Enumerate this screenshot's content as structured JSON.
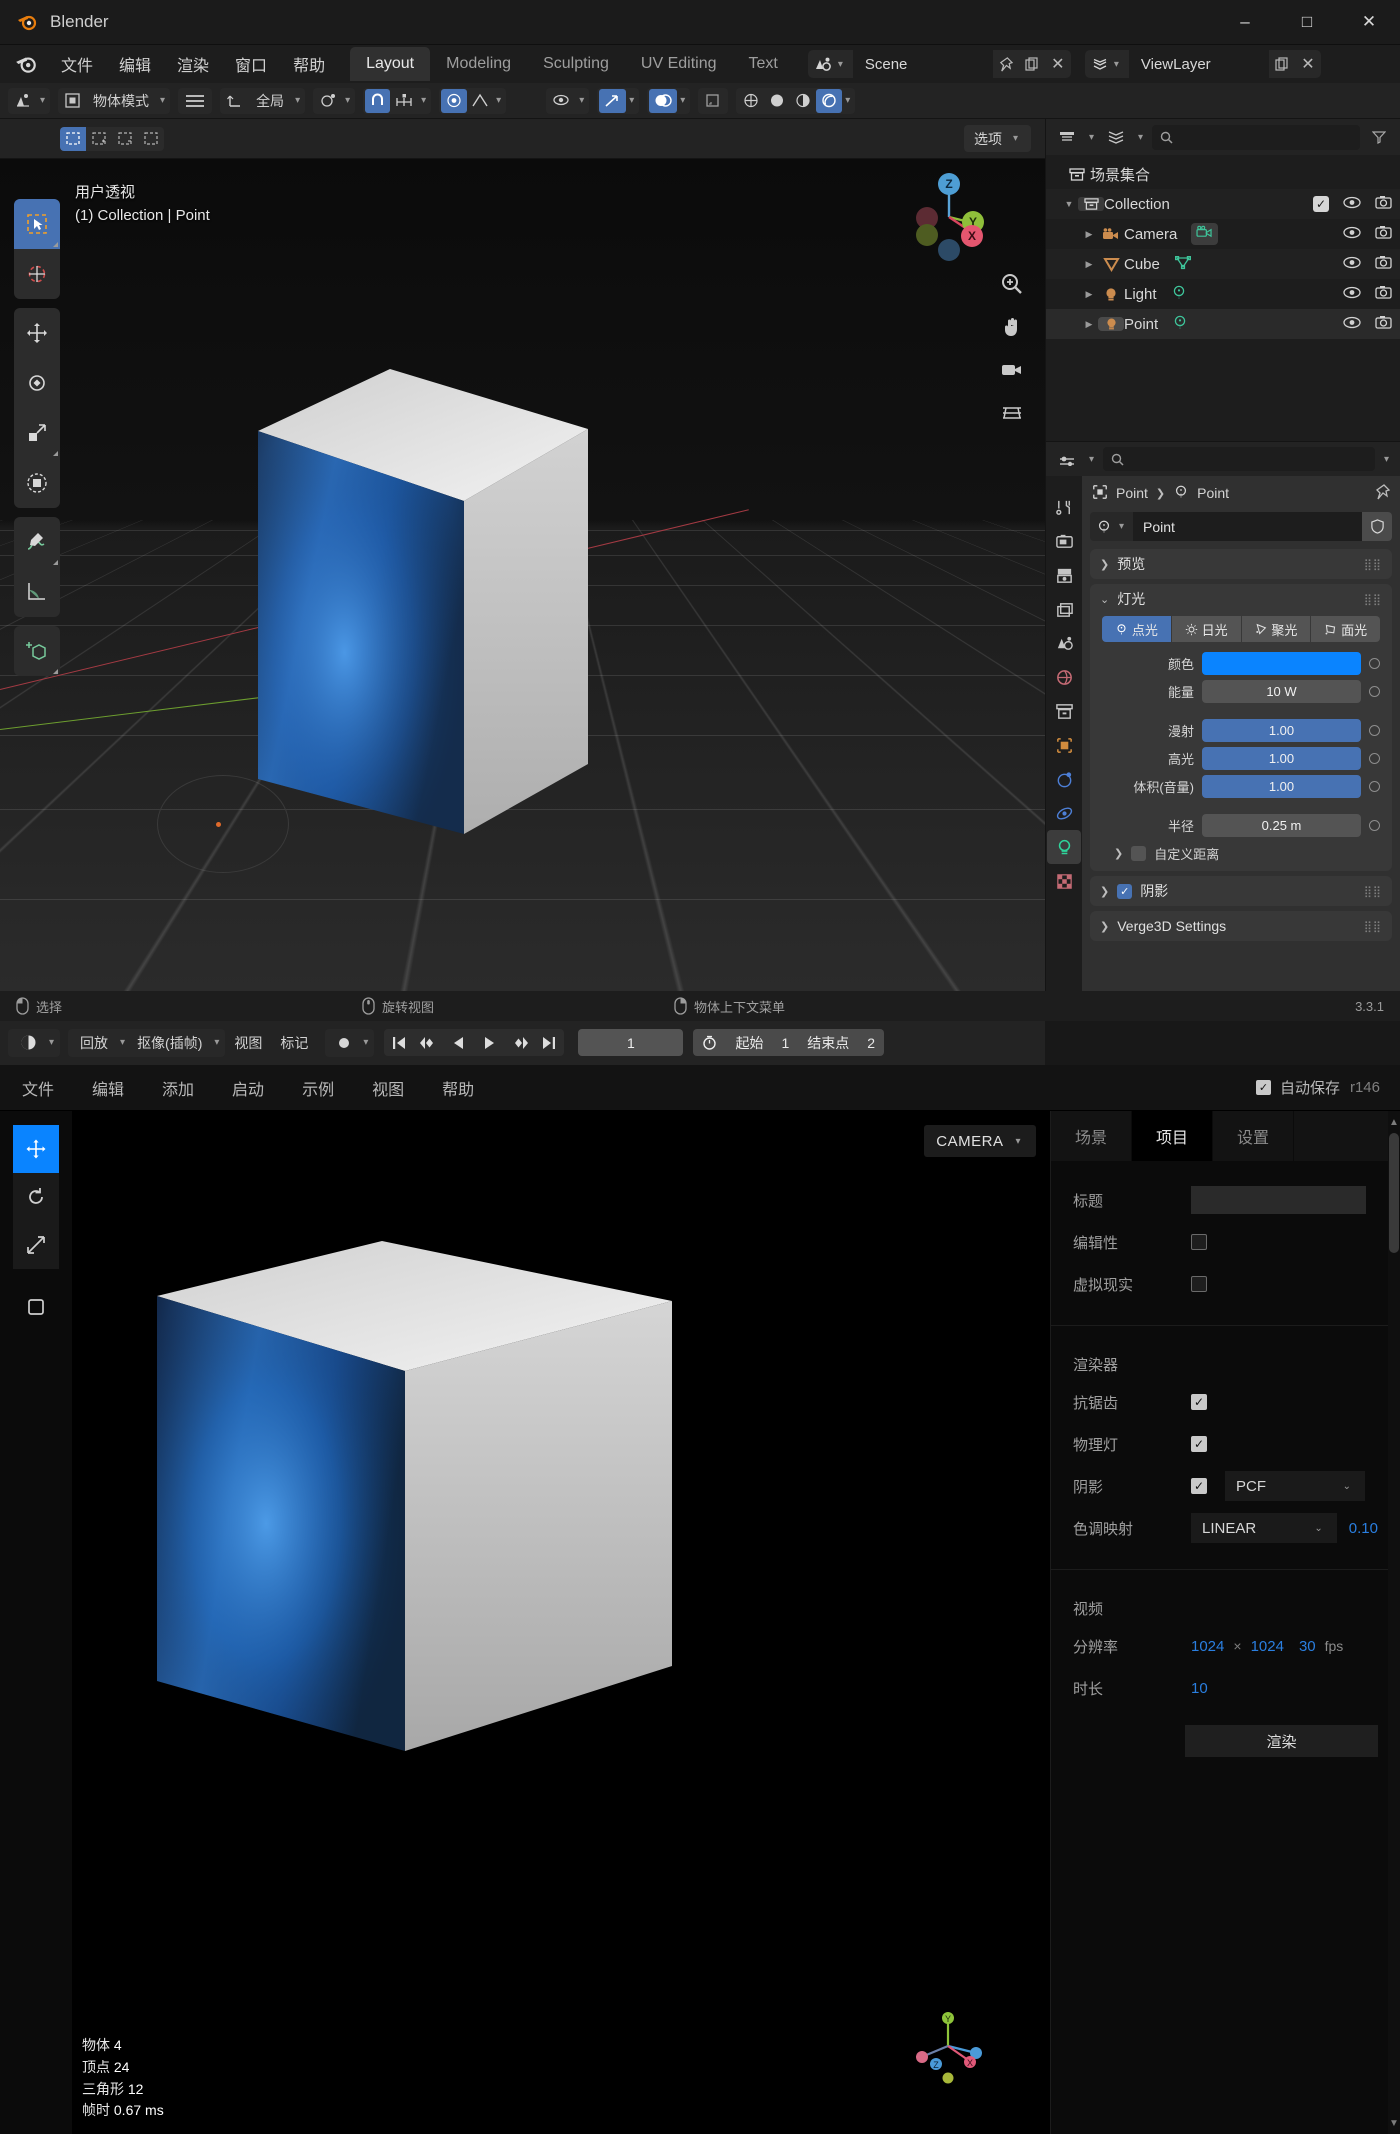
{
  "window": {
    "title": "Blender",
    "minimize": "–",
    "maximize": "□",
    "close": "✕"
  },
  "blender": {
    "menus": [
      "文件",
      "编辑",
      "渲染",
      "窗口",
      "帮助"
    ],
    "workspace_tabs": [
      {
        "label": "Layout",
        "active": true
      },
      {
        "label": "Modeling",
        "active": false
      },
      {
        "label": "Sculpting",
        "active": false
      },
      {
        "label": "UV Editing",
        "active": false
      },
      {
        "label": "Text",
        "active": false
      }
    ],
    "scene_name": "Scene",
    "view_layer_name": "ViewLayer",
    "header": {
      "mode": "物体模式",
      "transform_orientation": "全局"
    },
    "viewport": {
      "options_label": "选项",
      "overlay_line1": "用户透视",
      "overlay_line2": "(1) Collection | Point",
      "gizmo_axes": [
        "X",
        "Y",
        "Z"
      ]
    },
    "timeline": {
      "playback": "回放",
      "keying": "抠像(插帧)",
      "view": "视图",
      "marker": "标记",
      "current_frame": "1",
      "start_label": "起始",
      "start_value": "1",
      "end_label": "结束点",
      "end_value": "2"
    },
    "statusbar": {
      "select": "选择",
      "rotate_view": "旋转视图",
      "object_context_menu": "物体上下文菜单",
      "version": "3.3.1"
    },
    "outliner": {
      "scene_collection": "场景集合",
      "rows": [
        {
          "label": "Collection",
          "indent": 1,
          "icon": "collection-icon",
          "has_checkbox": true,
          "selected": false
        },
        {
          "label": "Camera",
          "indent": 2,
          "icon": "camera-icon",
          "has_checkbox": false,
          "selected": false
        },
        {
          "label": "Cube",
          "indent": 2,
          "icon": "mesh-icon",
          "has_checkbox": false,
          "selected": false
        },
        {
          "label": "Light",
          "indent": 2,
          "icon": "light-icon",
          "has_checkbox": false,
          "selected": false
        },
        {
          "label": "Point",
          "indent": 2,
          "icon": "light-icon",
          "has_checkbox": false,
          "selected": true
        }
      ]
    },
    "properties": {
      "breadcrumb_object": "Point",
      "breadcrumb_data": "Point",
      "id_name": "Point",
      "panel_preview": "预览",
      "panel_light": "灯光",
      "light_types": [
        {
          "label": "点光",
          "active": true
        },
        {
          "label": "日光",
          "active": false
        },
        {
          "label": "聚光",
          "active": false
        },
        {
          "label": "面光",
          "active": false
        }
      ],
      "fields": [
        {
          "label": "颜色",
          "value": "",
          "style": "color",
          "color": "#0a84ff"
        },
        {
          "label": "能量",
          "value": "10 W",
          "style": "grey"
        },
        {
          "label": "漫射",
          "value": "1.00",
          "style": "blue"
        },
        {
          "label": "高光",
          "value": "1.00",
          "style": "blue"
        },
        {
          "label": "体积(音量)",
          "value": "1.00",
          "style": "blue"
        },
        {
          "label": "半径",
          "value": "0.25 m",
          "style": "grey"
        }
      ],
      "custom_distance": "自定义距离",
      "panel_shadow": "阴影",
      "panel_verge3d": "Verge3D Settings"
    }
  },
  "verge3d": {
    "menus": [
      "文件",
      "编辑",
      "添加",
      "启动",
      "示例",
      "视图",
      "帮助"
    ],
    "autosave_label": "自动保存",
    "revision": "r146",
    "camera_label": "CAMERA",
    "stats": [
      {
        "label": "物体",
        "value": "4"
      },
      {
        "label": "顶点",
        "value": "24"
      },
      {
        "label": "三角形",
        "value": "12"
      },
      {
        "label": "帧时",
        "value": "0.67 ms"
      }
    ],
    "gizmo_axes": [
      "X",
      "Y",
      "Z"
    ],
    "tabs": [
      {
        "label": "场景",
        "active": false
      },
      {
        "label": "项目",
        "active": true
      },
      {
        "label": "设置",
        "active": false
      }
    ],
    "project": {
      "title_label": "标题",
      "title_value": "",
      "editable_label": "编辑性",
      "editable_checked": false,
      "vr_label": "虚拟现实",
      "vr_checked": false
    },
    "renderer": {
      "heading": "渲染器",
      "antialias_label": "抗锯齿",
      "antialias_checked": true,
      "physical_light_label": "物理灯",
      "physical_light_checked": true,
      "shadow_label": "阴影",
      "shadow_checked": true,
      "shadow_type": "PCF",
      "tonemap_label": "色调映射",
      "tonemap_value": "LINEAR",
      "tonemap_exposure": "0.10"
    },
    "video": {
      "heading": "视频",
      "resolution_label": "分辨率",
      "res_width": "1024",
      "res_sep": "×",
      "res_height": "1024",
      "fps_value": "30",
      "fps_unit": "fps",
      "duration_label": "时长",
      "duration_value": "10",
      "render_button": "渲染"
    }
  },
  "colors": {
    "accent_blue": "#4772b3",
    "v3d_blue": "#0a84ff",
    "link_blue": "#2a7fe0",
    "light_color": "#0a84ff"
  }
}
